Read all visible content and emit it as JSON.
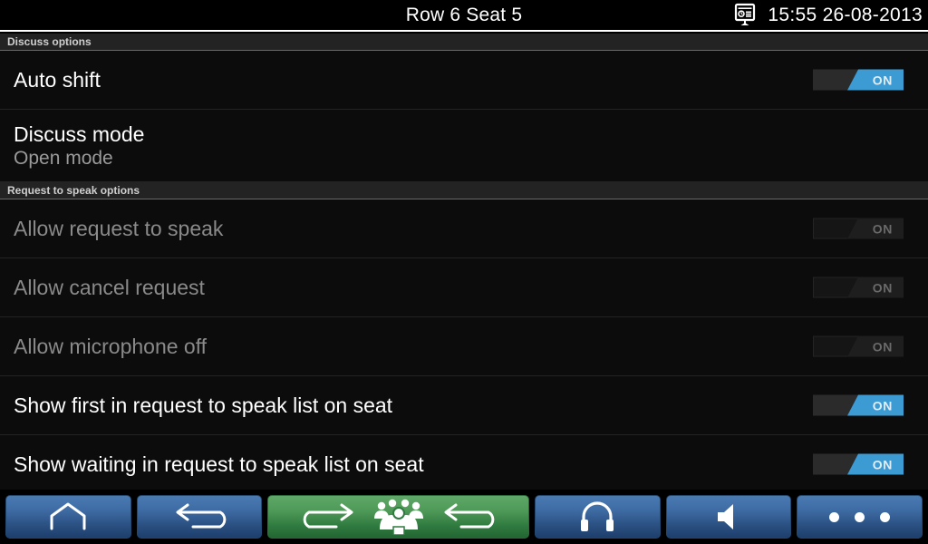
{
  "titlebar": {
    "title": "Row 6 Seat 5",
    "clock": "15:55 26-08-2013",
    "icon": "presentation-screen-icon"
  },
  "colors": {
    "accent_blue": "#3d9bd4",
    "nav_blue": "#3e6ba3",
    "nav_green": "#4f9a58",
    "background": "#0a0a0a",
    "section_header_bg": "#232323",
    "text_primary": "#ffffff",
    "text_dim": "#8a8a8a"
  },
  "sections": [
    {
      "header": "Discuss options",
      "rows": [
        {
          "title": "Auto shift",
          "subtitle": null,
          "enabled": true,
          "toggle": {
            "present": true,
            "state": "ON",
            "label": "ON",
            "active": true
          }
        },
        {
          "title": "Discuss mode",
          "subtitle": "Open mode",
          "enabled": true,
          "toggle": {
            "present": false
          }
        }
      ]
    },
    {
      "header": "Request to speak options",
      "rows": [
        {
          "title": "Allow request to speak",
          "subtitle": null,
          "enabled": false,
          "toggle": {
            "present": true,
            "state": "ON",
            "label": "ON",
            "active": false
          }
        },
        {
          "title": "Allow cancel request",
          "subtitle": null,
          "enabled": false,
          "toggle": {
            "present": true,
            "state": "ON",
            "label": "ON",
            "active": false
          }
        },
        {
          "title": "Allow microphone off",
          "subtitle": null,
          "enabled": false,
          "toggle": {
            "present": true,
            "state": "ON",
            "label": "ON",
            "active": false
          }
        },
        {
          "title": "Show first in request to speak list on seat",
          "subtitle": null,
          "enabled": true,
          "toggle": {
            "present": true,
            "state": "ON",
            "label": "ON",
            "active": true
          }
        },
        {
          "title": "Show waiting in request to speak list on seat",
          "subtitle": null,
          "enabled": true,
          "toggle": {
            "present": true,
            "state": "ON",
            "label": "ON",
            "active": true
          }
        }
      ]
    }
  ],
  "bottom_nav": [
    {
      "name": "home-button",
      "icon": "home-icon",
      "style": "blue"
    },
    {
      "name": "back-button",
      "icon": "back-arrow-icon",
      "style": "blue"
    },
    {
      "name": "discussion-button",
      "icon": "discussion-group-icon",
      "style": "green"
    },
    {
      "name": "headphones-button",
      "icon": "headphones-icon",
      "style": "blue"
    },
    {
      "name": "speaker-button",
      "icon": "speaker-icon",
      "style": "blue"
    },
    {
      "name": "more-button",
      "icon": "overflow-dots-icon",
      "style": "blue"
    }
  ]
}
